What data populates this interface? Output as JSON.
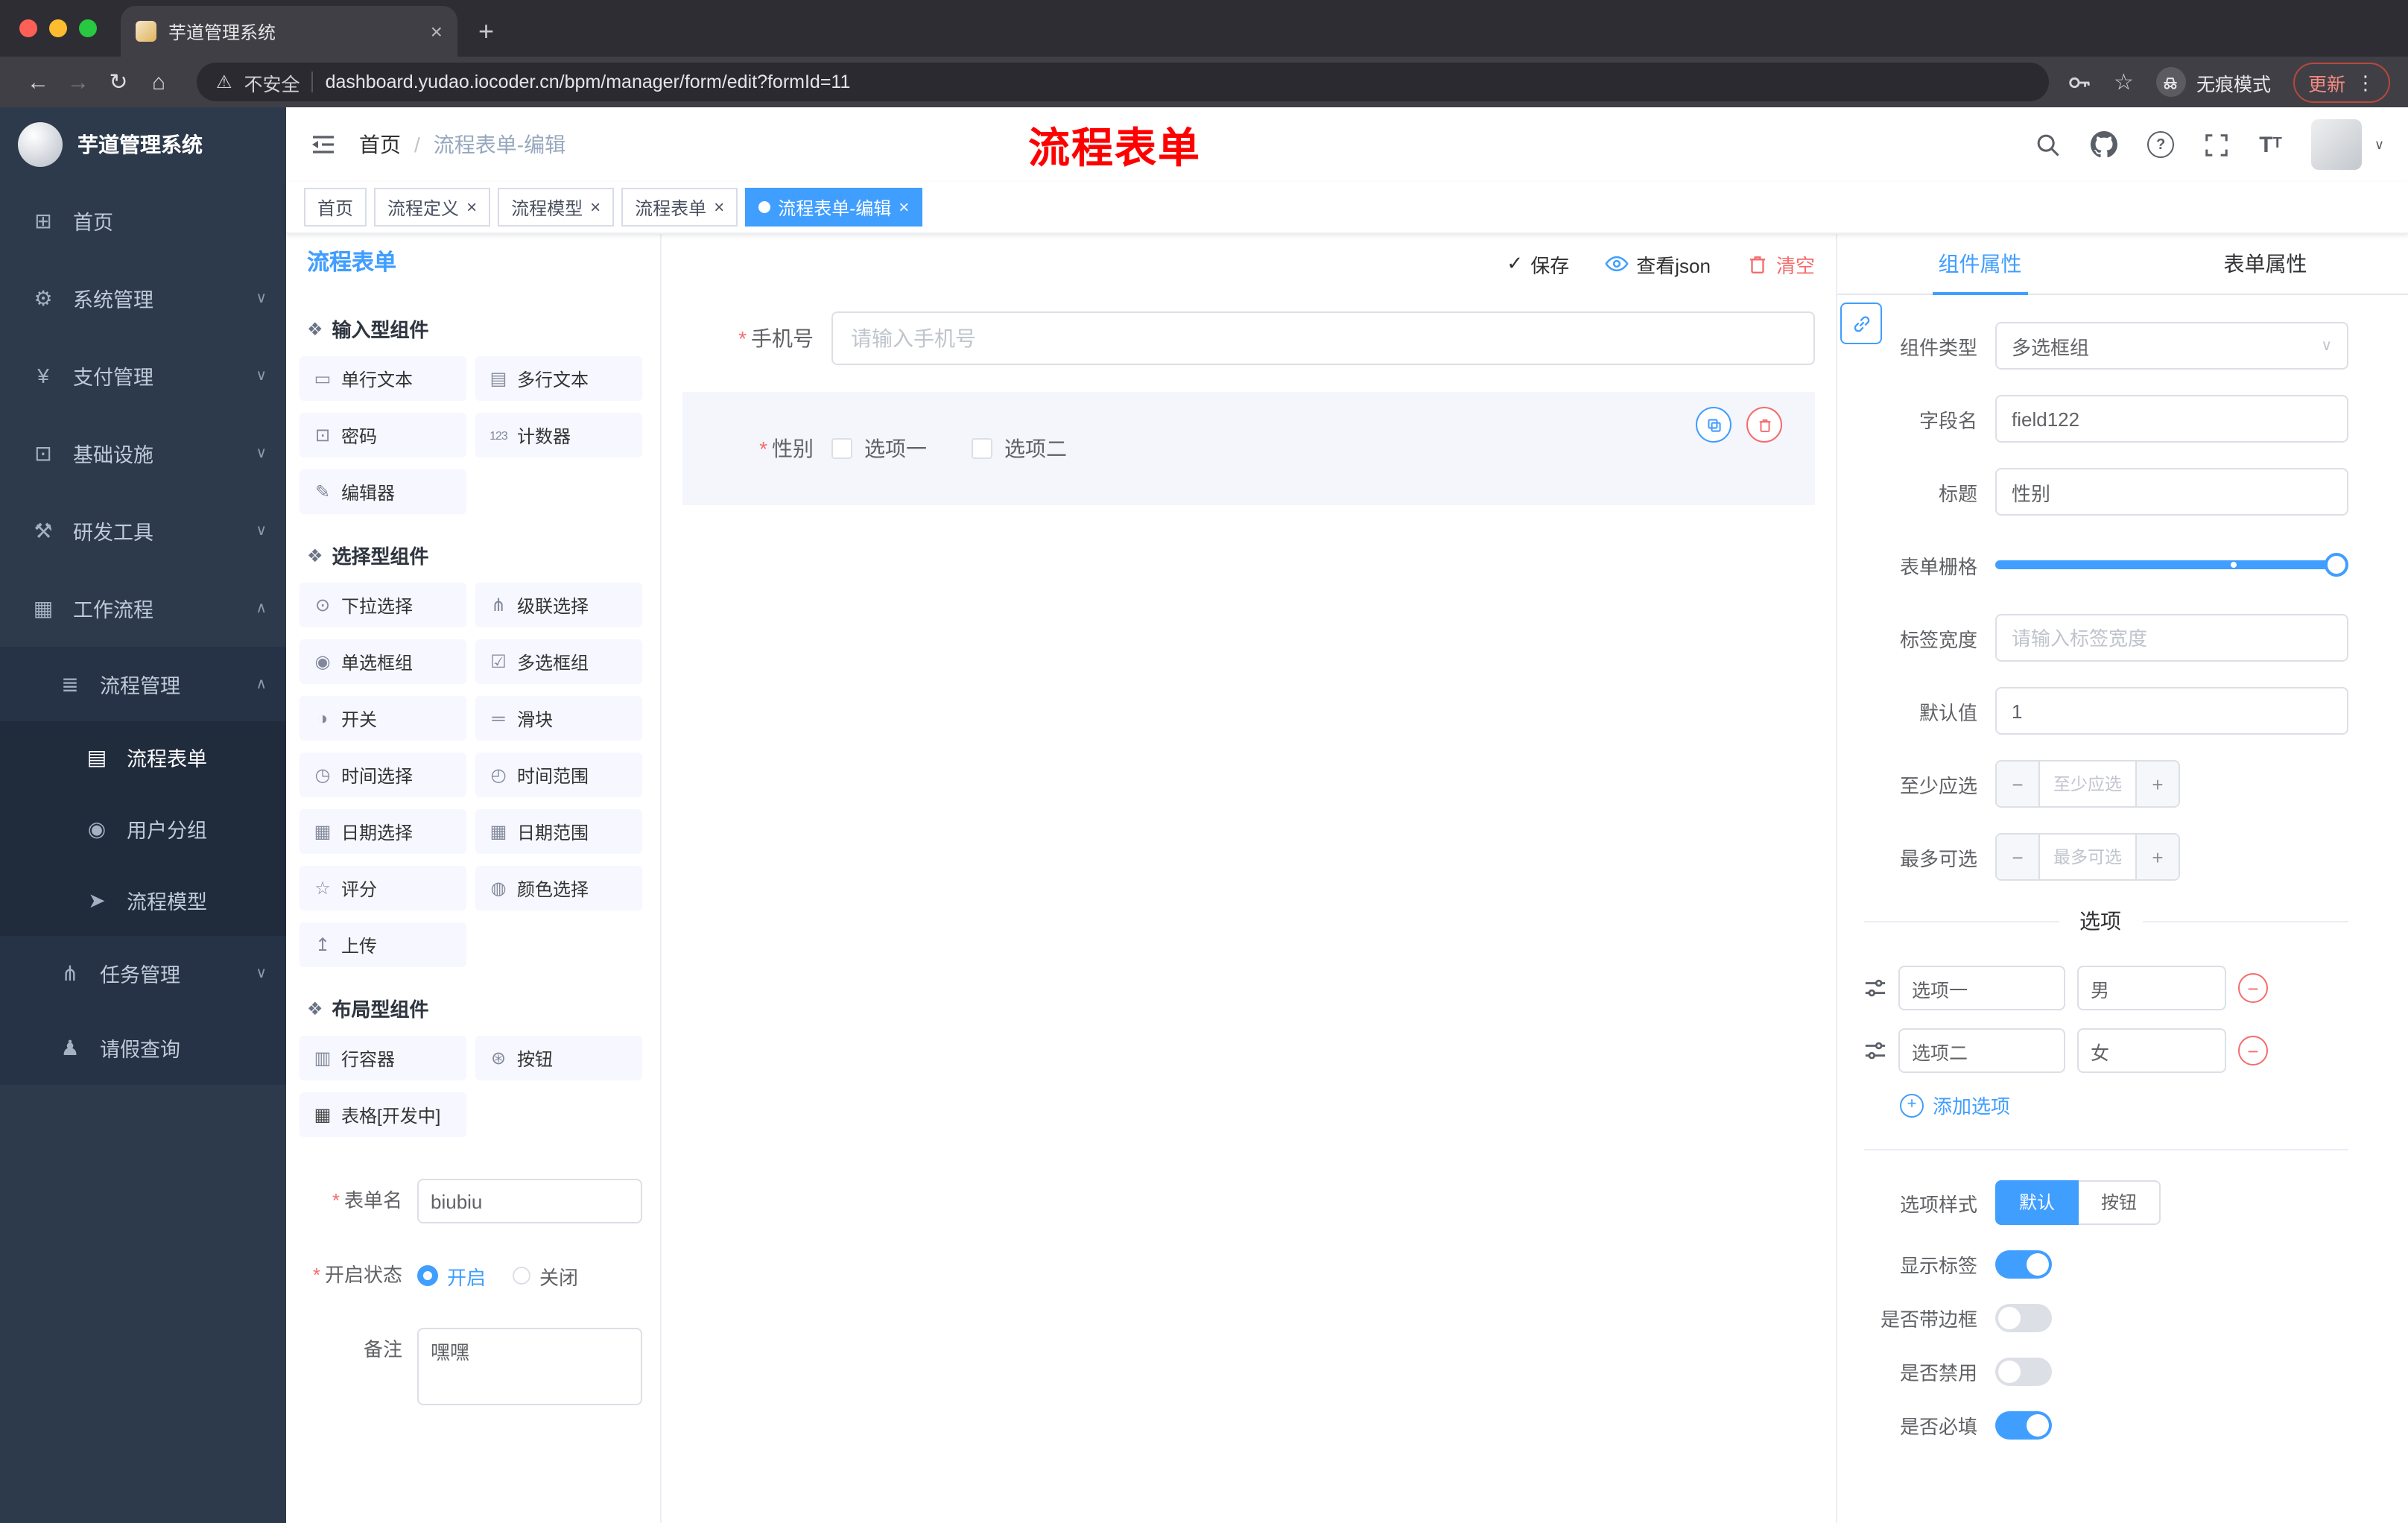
{
  "browser": {
    "tab_title": "芋道管理系统",
    "security_label": "不安全",
    "url": "dashboard.yudao.iocoder.cn/bpm/manager/form/edit?formId=11",
    "incognito_label": "无痕模式",
    "update_label": "更新"
  },
  "sidebar": {
    "title": "芋道管理系统",
    "items": [
      {
        "name": "home",
        "glyph": "⊞",
        "label": "首页"
      },
      {
        "name": "system-management",
        "glyph": "⚙",
        "label": "系统管理"
      },
      {
        "name": "payment-management",
        "glyph": "¥",
        "label": "支付管理"
      },
      {
        "name": "infrastructure",
        "glyph": "⊡",
        "label": "基础设施"
      },
      {
        "name": "dev-tools",
        "glyph": "⚒",
        "label": "研发工具"
      },
      {
        "name": "workflow",
        "glyph": "▦",
        "label": "工作流程"
      },
      {
        "name": "process-management",
        "glyph": "≣",
        "label": "流程管理"
      },
      {
        "name": "process-form",
        "glyph": "▤",
        "label": "流程表单"
      },
      {
        "name": "user-group",
        "glyph": "◉",
        "label": "用户分组"
      },
      {
        "name": "process-model",
        "glyph": "➤",
        "label": "流程模型"
      },
      {
        "name": "task-management",
        "glyph": "⋔",
        "label": "任务管理"
      },
      {
        "name": "leave-query",
        "glyph": "♟",
        "label": "请假查询"
      }
    ]
  },
  "header": {
    "breadcrumb": {
      "home": "首页",
      "separator": "/",
      "current": "流程表单-编辑"
    },
    "annotation": "流程表单"
  },
  "tags": [
    {
      "label": "首页",
      "active": false,
      "closable": false
    },
    {
      "label": "流程定义",
      "active": false,
      "closable": true
    },
    {
      "label": "流程模型",
      "active": false,
      "closable": true
    },
    {
      "label": "流程表单",
      "active": false,
      "closable": true
    },
    {
      "label": "流程表单-编辑",
      "active": true,
      "closable": true
    }
  ],
  "palette": {
    "title": "流程表单",
    "groups": [
      {
        "title": "输入型组件",
        "items": [
          {
            "glyph": "▭",
            "label": "单行文本"
          },
          {
            "glyph": "▤",
            "label": "多行文本"
          },
          {
            "glyph": "⊡",
            "label": "密码"
          },
          {
            "glyph": "123",
            "label": "计数器"
          },
          {
            "glyph": "✎",
            "label": "编辑器"
          }
        ]
      },
      {
        "title": "选择型组件",
        "items": [
          {
            "glyph": "⊙",
            "label": "下拉选择"
          },
          {
            "glyph": "⋔",
            "label": "级联选择"
          },
          {
            "glyph": "◉",
            "label": "单选框组"
          },
          {
            "glyph": "☑",
            "label": "多选框组"
          },
          {
            "glyph": "◑",
            "label": "开关"
          },
          {
            "glyph": "═",
            "label": "滑块"
          },
          {
            "glyph": "◷",
            "label": "时间选择"
          },
          {
            "glyph": "◴",
            "label": "时间范围"
          },
          {
            "glyph": "▦",
            "label": "日期选择"
          },
          {
            "glyph": "▦",
            "label": "日期范围"
          },
          {
            "glyph": "☆",
            "label": "评分"
          },
          {
            "glyph": "◍",
            "label": "颜色选择"
          },
          {
            "glyph": "↥",
            "label": "上传"
          }
        ]
      },
      {
        "title": "布局型组件",
        "items": [
          {
            "glyph": "▥",
            "label": "行容器"
          },
          {
            "glyph": "⊛",
            "label": "按钮"
          },
          {
            "glyph": "▦",
            "label": "表格[开发中]"
          }
        ]
      }
    ],
    "settings": {
      "form_name_label": "表单名",
      "form_name_value": "biubiu",
      "status_label": "开启状态",
      "status_on": "开启",
      "status_off": "关闭",
      "remark_label": "备注",
      "remark_value": "嘿嘿"
    }
  },
  "canvas": {
    "toolbar": {
      "save": "保存",
      "view_json": "查看json",
      "clear": "清空"
    },
    "phone": {
      "label": "手机号",
      "placeholder": "请输入手机号"
    },
    "gender": {
      "label": "性别",
      "options": [
        "选项一",
        "选项二"
      ]
    }
  },
  "inspector": {
    "tabs": {
      "component": "组件属性",
      "form": "表单属性"
    },
    "fields": [
      {
        "label": "组件类型",
        "value": "多选框组"
      },
      {
        "label": "字段名",
        "value": "field122"
      },
      {
        "label": "标题",
        "value": "性别"
      },
      {
        "label": "表单栅格"
      },
      {
        "label": "标签宽度",
        "placeholder": "请输入标签宽度"
      },
      {
        "label": "默认值",
        "value": "1"
      },
      {
        "label": "至少应选",
        "placeholder": "至少应选"
      },
      {
        "label": "最多可选",
        "placeholder": "最多可选"
      }
    ],
    "options_title": "选项",
    "options": [
      {
        "label": "选项一",
        "value": "男"
      },
      {
        "label": "选项二",
        "value": "女"
      }
    ],
    "add_option": "添加选项",
    "style": {
      "label": "选项样式",
      "default": "默认",
      "button": "按钮",
      "selected": "默认"
    },
    "switches": [
      {
        "label": "显示标签",
        "on": true
      },
      {
        "label": "是否带边框",
        "on": false
      },
      {
        "label": "是否禁用",
        "on": false
      },
      {
        "label": "是否必填",
        "on": true
      }
    ]
  },
  "colors": {
    "accent": "#409eff",
    "danger": "#f56c6c",
    "annotation": "#fe0000",
    "sidebar": "#2d3a4b"
  }
}
